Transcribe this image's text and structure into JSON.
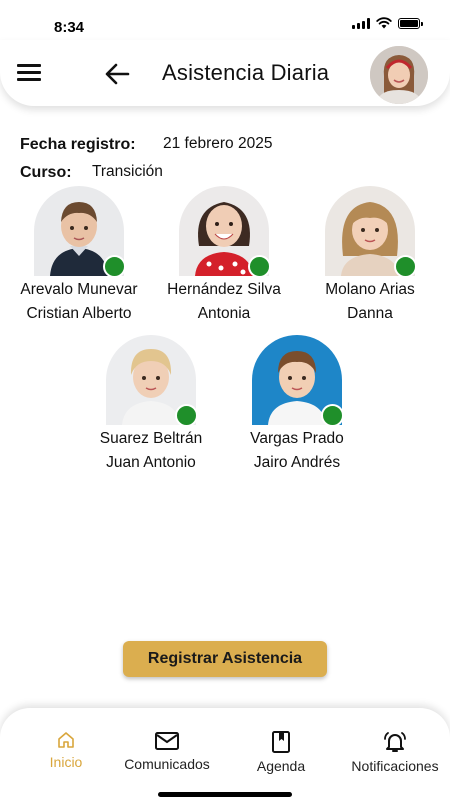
{
  "status_bar": {
    "time": "8:34"
  },
  "header": {
    "title": "Asistencia Diaria"
  },
  "info": {
    "date_label": "Fecha registro:",
    "date_value": "21 febrero 2025",
    "course_label": "Curso:",
    "course_value": "Transición"
  },
  "students": [
    {
      "line1": "Arevalo Munevar",
      "line2": "Cristian Alberto",
      "status": "present"
    },
    {
      "line1": "Hernández Silva",
      "line2": "Antonia",
      "status": "present"
    },
    {
      "line1": "Molano Arias",
      "line2": "Danna",
      "status": "present"
    },
    {
      "line1": "Suarez Beltrán",
      "line2": "Juan Antonio",
      "status": "present"
    },
    {
      "line1": "Vargas Prado",
      "line2": "Jairo Andrés",
      "status": "present"
    }
  ],
  "actions": {
    "register_label": "Registrar Asistencia"
  },
  "nav": {
    "items": [
      {
        "label": "Inicio",
        "icon": "home-icon",
        "active": true
      },
      {
        "label": "Comunicados",
        "icon": "mail-icon",
        "active": false
      },
      {
        "label": "Agenda",
        "icon": "book-icon",
        "active": false
      },
      {
        "label": "Notificaciones",
        "icon": "bell-icon",
        "active": false
      }
    ]
  },
  "colors": {
    "accent": "#dbae4f",
    "status_present": "#1f8f2a",
    "nav_active": "#d9a63c"
  }
}
